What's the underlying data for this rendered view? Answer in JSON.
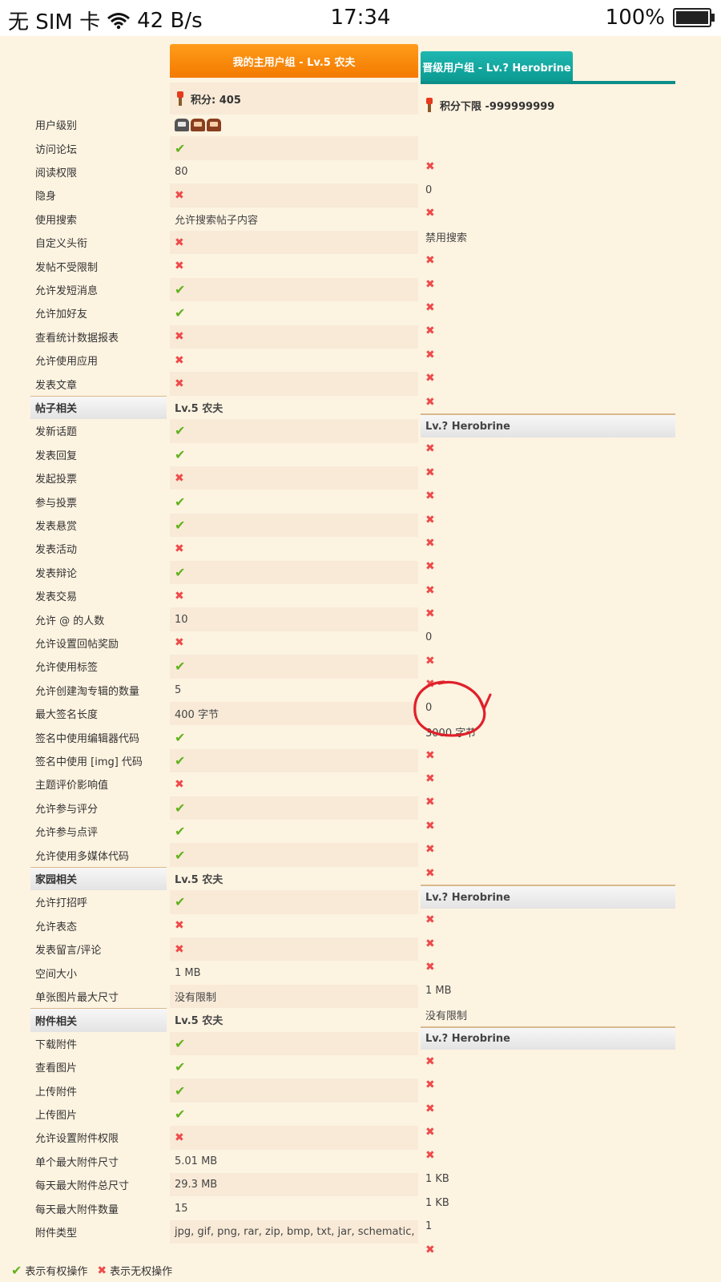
{
  "status": {
    "carrier": "无 SIM 卡",
    "speed": "42 B/s",
    "time": "17:34",
    "battery": "100%"
  },
  "tabs": {
    "main_group": "我的主用户组 - Lv.5 农夫",
    "upgrade_group": "晋级用户组 - Lv.? Herobrine"
  },
  "points": {
    "main": "积分: 405",
    "upgrade": "积分下限 -999999999"
  },
  "rows": [
    {
      "label": "用户级别",
      "main": "icons",
      "up": ""
    },
    {
      "label": "访问论坛",
      "main": "check",
      "up": "cross"
    },
    {
      "label": "阅读权限",
      "main": "80",
      "up": "0"
    },
    {
      "label": "隐身",
      "main": "cross",
      "up": "cross"
    },
    {
      "label": "使用搜索",
      "main": "允许搜索帖子内容",
      "up": "禁用搜索"
    },
    {
      "label": "自定义头衔",
      "main": "cross",
      "up": "cross"
    },
    {
      "label": "发帖不受限制",
      "main": "cross",
      "up": "cross"
    },
    {
      "label": "允许发短消息",
      "main": "check",
      "up": "cross"
    },
    {
      "label": "允许加好友",
      "main": "check",
      "up": "cross"
    },
    {
      "label": "查看统计数据报表",
      "main": "cross",
      "up": "cross"
    },
    {
      "label": "允许使用应用",
      "main": "cross",
      "up": "cross"
    },
    {
      "label": "发表文章",
      "main": "cross",
      "up": "cross"
    },
    {
      "label": "帖子相关",
      "main": "Lv.5 农夫",
      "up": "Lv.? Herobrine",
      "section": true
    },
    {
      "label": "发新话题",
      "main": "check",
      "up": "cross"
    },
    {
      "label": "发表回复",
      "main": "check",
      "up": "cross"
    },
    {
      "label": "发起投票",
      "main": "cross",
      "up": "cross"
    },
    {
      "label": "参与投票",
      "main": "check",
      "up": "cross"
    },
    {
      "label": "发表悬赏",
      "main": "check",
      "up": "cross"
    },
    {
      "label": "发表活动",
      "main": "cross",
      "up": "cross"
    },
    {
      "label": "发表辩论",
      "main": "check",
      "up": "cross"
    },
    {
      "label": "发表交易",
      "main": "cross",
      "up": "cross"
    },
    {
      "label": "允许 @ 的人数",
      "main": "10",
      "up": "0"
    },
    {
      "label": "允许设置回帖奖励",
      "main": "cross",
      "up": "cross"
    },
    {
      "label": "允许使用标签",
      "main": "check",
      "up": "cross"
    },
    {
      "label": "允许创建淘专辑的数量",
      "main": "5",
      "up": "0"
    },
    {
      "label": "最大签名长度",
      "main": "400 字节",
      "up": "3000 字节"
    },
    {
      "label": "签名中使用编辑器代码",
      "main": "check",
      "up": "cross"
    },
    {
      "label": "签名中使用 [img] 代码",
      "main": "check",
      "up": "cross"
    },
    {
      "label": "主题评价影响值",
      "main": "cross",
      "up": "cross"
    },
    {
      "label": "允许参与评分",
      "main": "check",
      "up": "cross"
    },
    {
      "label": "允许参与点评",
      "main": "check",
      "up": "cross"
    },
    {
      "label": "允许使用多媒体代码",
      "main": "check",
      "up": "cross"
    },
    {
      "label": "家园相关",
      "main": "Lv.5 农夫",
      "up": "Lv.? Herobrine",
      "section": true
    },
    {
      "label": "允许打招呼",
      "main": "check",
      "up": "cross"
    },
    {
      "label": "允许表态",
      "main": "cross",
      "up": "cross"
    },
    {
      "label": "发表留言/评论",
      "main": "cross",
      "up": "cross"
    },
    {
      "label": "空间大小",
      "main": "1 MB",
      "up": "1 MB"
    },
    {
      "label": "单张图片最大尺寸",
      "main": "没有限制",
      "up": "没有限制"
    },
    {
      "label": "附件相关",
      "main": "Lv.5 农夫",
      "up": "Lv.? Herobrine",
      "section": true
    },
    {
      "label": "下载附件",
      "main": "check",
      "up": "cross"
    },
    {
      "label": "查看图片",
      "main": "check",
      "up": "cross"
    },
    {
      "label": "上传附件",
      "main": "check",
      "up": "cross"
    },
    {
      "label": "上传图片",
      "main": "check",
      "up": "cross"
    },
    {
      "label": "允许设置附件权限",
      "main": "cross",
      "up": "cross"
    },
    {
      "label": "单个最大附件尺寸",
      "main": "5.01 MB",
      "up": "1 KB"
    },
    {
      "label": "每天最大附件总尺寸",
      "main": "29.3 MB",
      "up": "1 KB"
    },
    {
      "label": "每天最大附件数量",
      "main": "15",
      "up": "1"
    },
    {
      "label": "附件类型",
      "main": "jpg, gif, png, rar, zip, bmp, txt, jar, schematic, yml, cf",
      "up": "cross"
    }
  ],
  "legend": {
    "has": "表示有权操作",
    "none": "表示无权操作"
  },
  "colors": {
    "page_bg": "#fdf3e1",
    "main_tab": "#f37a00",
    "upgrade_tab": "#0b9a92",
    "check": "#62b21e",
    "cross": "#ee4a4a",
    "annotation": "#e0202a"
  }
}
